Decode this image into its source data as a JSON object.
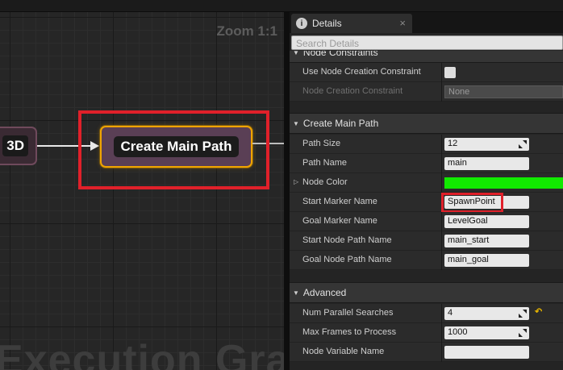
{
  "graph": {
    "zoom_label": "Zoom 1:1",
    "watermark": "Execution Graph",
    "nodes": [
      {
        "title": "3D"
      },
      {
        "title": "Create Main Path"
      }
    ]
  },
  "details": {
    "tab_title": "Details",
    "tab_close": "×",
    "search_placeholder": "Search Details",
    "categories": {
      "node_constraints": "Node Constraints",
      "create_main_path": "Create Main Path",
      "advanced": "Advanced"
    },
    "rows": {
      "use_node_creation_constraint": {
        "label": "Use Node Creation Constraint",
        "checked": false
      },
      "node_creation_constraint": {
        "label": "Node Creation Constraint",
        "value": "None"
      },
      "path_size": {
        "label": "Path Size",
        "value": "12"
      },
      "path_name": {
        "label": "Path Name",
        "value": "main"
      },
      "node_color": {
        "label": "Node Color",
        "color": "#11ea00"
      },
      "start_marker_name": {
        "label": "Start Marker Name",
        "value": "SpawnPoint"
      },
      "goal_marker_name": {
        "label": "Goal Marker Name",
        "value": "LevelGoal"
      },
      "start_node_path_name": {
        "label": "Start Node Path Name",
        "value": "main_start"
      },
      "goal_node_path_name": {
        "label": "Goal Node Path Name",
        "value": "main_goal"
      },
      "num_parallel_searches": {
        "label": "Num Parallel Searches",
        "value": "4"
      },
      "max_frames_to_process": {
        "label": "Max Frames to Process",
        "value": "1000"
      },
      "node_variable_name": {
        "label": "Node Variable Name",
        "value": ""
      }
    }
  },
  "colors": {
    "highlight_red": "#e0202a",
    "node_selected_border": "#f0a400",
    "node_color_value": "#11ea00"
  }
}
